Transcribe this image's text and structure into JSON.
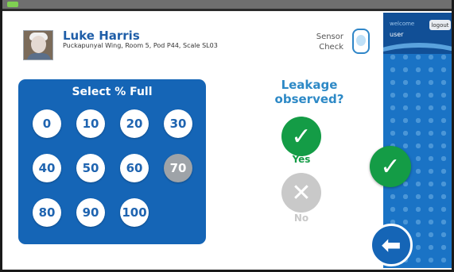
{
  "header": {
    "patient_name": "Luke Harris",
    "patient_details": "Puckapunyal Wing, Room 5, Pod P44, Scale SL03",
    "sensor_check_line1": "Sensor",
    "sensor_check_line2": "Check"
  },
  "select_panel": {
    "title": "Select % Full",
    "options": [
      "0",
      "10",
      "20",
      "30",
      "40",
      "50",
      "60",
      "70",
      "80",
      "90",
      "100"
    ],
    "selected": "70"
  },
  "leakage": {
    "question_line1": "Leakage",
    "question_line2": "observed?",
    "yes_label": "Yes",
    "no_label": "No",
    "selected": "Yes"
  },
  "sidebar": {
    "welcome_label": "welcome",
    "username": "user",
    "logout_label": "logout"
  },
  "icons": {
    "check_mark": "check-icon",
    "cross_mark": "cross-icon",
    "back_arrow": "back-arrow-icon",
    "sensor": "sensor-icon"
  },
  "colors": {
    "brand_blue": "#1565b6",
    "selected_gray": "#9ea3a8",
    "confirm_green": "#149c46",
    "disabled_gray": "#c9c9c9"
  }
}
